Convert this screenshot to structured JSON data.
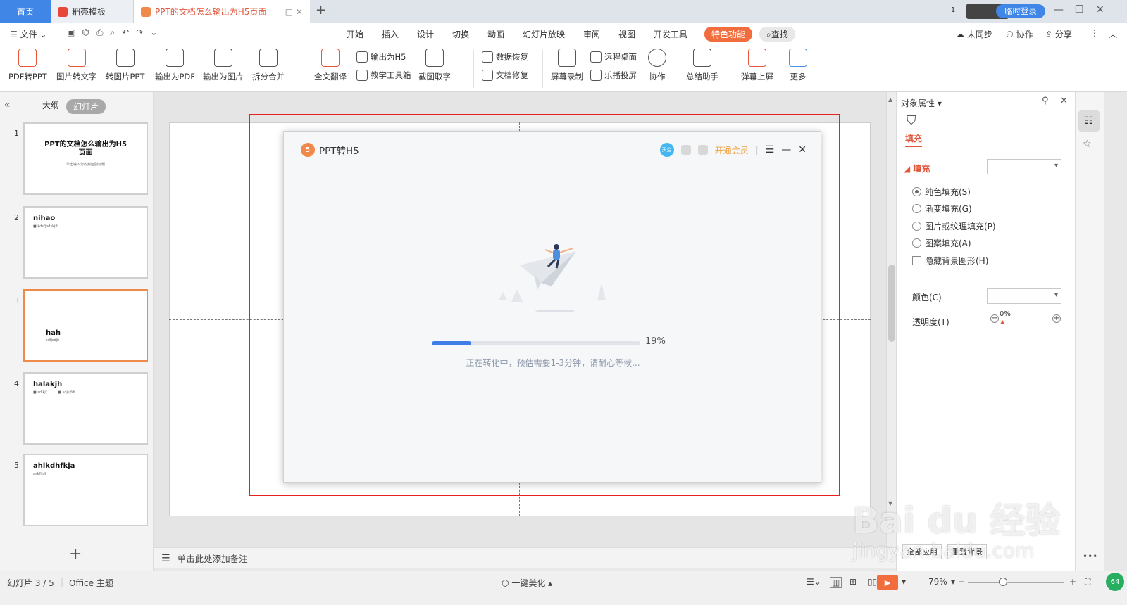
{
  "tabs": [
    {
      "label": "首页"
    },
    {
      "label": "稻壳模板"
    },
    {
      "label": "PPT的文档怎么输出为H5页面"
    }
  ],
  "top_right": {
    "page_indicator": "1",
    "login_label": "临时登录"
  },
  "menu": {
    "file_label": "文件",
    "tabs": [
      "开始",
      "插入",
      "设计",
      "切换",
      "动画",
      "幻灯片放映",
      "审阅",
      "视图",
      "开发工具",
      "特色功能"
    ],
    "search_label": "查找",
    "sync_label": "未同步",
    "collab_label": "协作",
    "share_label": "分享"
  },
  "ribbon": {
    "pdf_to_ppt": "PDF转PPT",
    "img_to_text": "图片转文字",
    "to_img_ppt": "转图片PPT",
    "export_pdf": "输出为PDF",
    "export_img": "输出为图片",
    "split_merge": "拆分合并",
    "translate": "全文翻译",
    "export_h5": "输出为H5",
    "teach_tools": "教学工具箱",
    "screenshot_text": "截图取字",
    "data_recovery": "数据恢复",
    "doc_repair": "文档修复",
    "screen_record": "屏幕录制",
    "remote_desktop": "远程桌面",
    "cast": "乐播投屏",
    "collab": "协作",
    "summary": "总结助手",
    "danmu": "弹幕上屏",
    "more": "更多"
  },
  "left_panel": {
    "tab_outline": "大纲",
    "tab_slides": "幻灯片",
    "slides": [
      {
        "num": "1",
        "title": "PPT的文档怎么输出为H5\n页面",
        "subtitle": "单击输入您的封面副标题"
      },
      {
        "num": "2",
        "title": "nihao",
        "subtitle": "■ kdsfjhdskjfh"
      },
      {
        "num": "3",
        "title": "hah",
        "subtitle": "sdfjsdjh"
      },
      {
        "num": "4",
        "title": "halakjh",
        "subtitle": "■ sdjkjf          ■ sdjkjfdf"
      },
      {
        "num": "5",
        "title": "ahlkdhfkja",
        "subtitle": "askfhdf"
      }
    ],
    "add_slide": "+"
  },
  "dialog": {
    "title": "PPT转H5",
    "avatar_text": "天空",
    "vip_label": "开通会员",
    "progress": 0.19,
    "progress_text": "19%",
    "status_message": "正在转化中，预估需要1-3分钟，请耐心等候..."
  },
  "right_panel": {
    "header": "对象属性",
    "tab_fill": "填充",
    "section_fill": "填充",
    "options": [
      {
        "label": "纯色填充(S)",
        "selected": true
      },
      {
        "label": "渐变填充(G)",
        "selected": false
      },
      {
        "label": "图片或纹理填充(P)",
        "selected": false
      },
      {
        "label": "图案填充(A)",
        "selected": false
      }
    ],
    "hide_bg_label": "隐藏背景图形(H)",
    "color_label": "颜色(C)",
    "transparency_label": "透明度(T)",
    "transparency_value": "0%",
    "apply_all": "全部应用",
    "reset_bg": "重置背景"
  },
  "notes_placeholder": "单击此处添加备注",
  "status_bar": {
    "slide_info": "幻灯片 3 / 5",
    "theme": "Office 主题",
    "beautify": "一键美化",
    "zoom": "79%",
    "badge": "64"
  },
  "watermark": {
    "brand": "Bai du 经验",
    "url": "jingyan.baidu.com"
  },
  "colors": {
    "accent": "#f26d3d",
    "tab_blue": "#3f86e6",
    "progress": "#3e7ee6",
    "highlight": "#e52222"
  }
}
